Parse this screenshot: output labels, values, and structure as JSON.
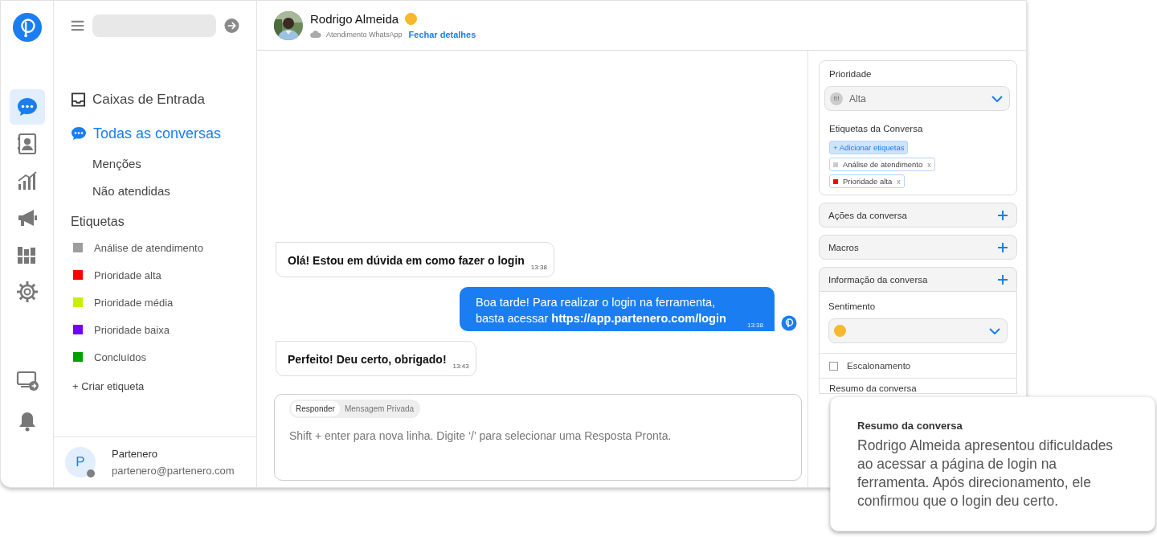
{
  "rail": {
    "items": [
      {
        "selected": true
      },
      {
        "selected": false
      },
      {
        "selected": false
      },
      {
        "selected": false
      },
      {
        "selected": false
      },
      {
        "selected": false
      }
    ]
  },
  "sidebar": {
    "nav": [
      {
        "label": "Caixas de Entrada",
        "kind": "heading",
        "selected": false
      },
      {
        "label": "Todas as conversas",
        "kind": "heading",
        "selected": true
      },
      {
        "label": "Menções",
        "kind": "sub",
        "selected": false
      },
      {
        "label": "Não atendidas",
        "kind": "sub",
        "selected": false
      }
    ],
    "labels_title": "Etiquetas",
    "labels": [
      {
        "name": "Análise de atendimento",
        "color": "#9e9e9e"
      },
      {
        "name": "Prioridade alta",
        "color": "#ff0000"
      },
      {
        "name": "Prioridade média",
        "color": "#c6f000"
      },
      {
        "name": "Prioridade baixa",
        "color": "#7000ff"
      },
      {
        "name": "Concluídos",
        "color": "#00a000"
      }
    ],
    "create_label": "+ Criar etiqueta",
    "user": {
      "initial": "P",
      "name": "Partenero",
      "email": "partenero@partenero.com",
      "online": false
    }
  },
  "header": {
    "name": "Rodrigo Almeida",
    "channel": "Atendimento WhatsApp",
    "link": "Fechar detalhes"
  },
  "messages": [
    {
      "kind": "incoming",
      "text": "Olá! Estou em dúvida em como fazer o login",
      "time": "13:38"
    },
    {
      "kind": "outgoing",
      "text": "Boa tarde! Para realizar o login na ferramenta, basta acessar **https://app.partenero.com/login**",
      "time": "13:38"
    },
    {
      "kind": "incoming",
      "text": "Perfeito! Deu certo, obrigado!",
      "time": "13:43"
    }
  ],
  "composer": {
    "tabs": [
      {
        "label": "Responder",
        "selected": true
      },
      {
        "label": "Mensagem Privada",
        "selected": false
      }
    ],
    "placeholder": "Shift + enter para nova linha. Digite ‘/’ para selecionar uma Resposta Pronta."
  },
  "details": {
    "priority": {
      "title": "Prioridade",
      "icon_text": "!!!",
      "value": "Alta"
    },
    "tags": {
      "title": "Etiquetas da Conversa",
      "add": "+ Adicionar etiquetas",
      "items": [
        {
          "name": "Análise de atendimento",
          "color": "#cccccc",
          "remove": "x"
        },
        {
          "name": "Prioridade alta",
          "color": "#ff0000",
          "remove": "x"
        }
      ]
    },
    "sections": [
      {
        "title": "Ações da conversa"
      },
      {
        "title": "Macros"
      },
      {
        "title": "Informação da conversa"
      }
    ],
    "sentiment": {
      "title": "Sentimento"
    },
    "escalation": {
      "label": "Escalonamento",
      "checked": false
    },
    "summary_title": "Resumo da conversa"
  },
  "summary_popup": {
    "title": "Resumo da conversa",
    "text": "Rodrigo Almeida apresentou dificuldades ao acessar a página de login na ferramenta. Após direcionamento, ele confirmou que o login deu certo."
  }
}
